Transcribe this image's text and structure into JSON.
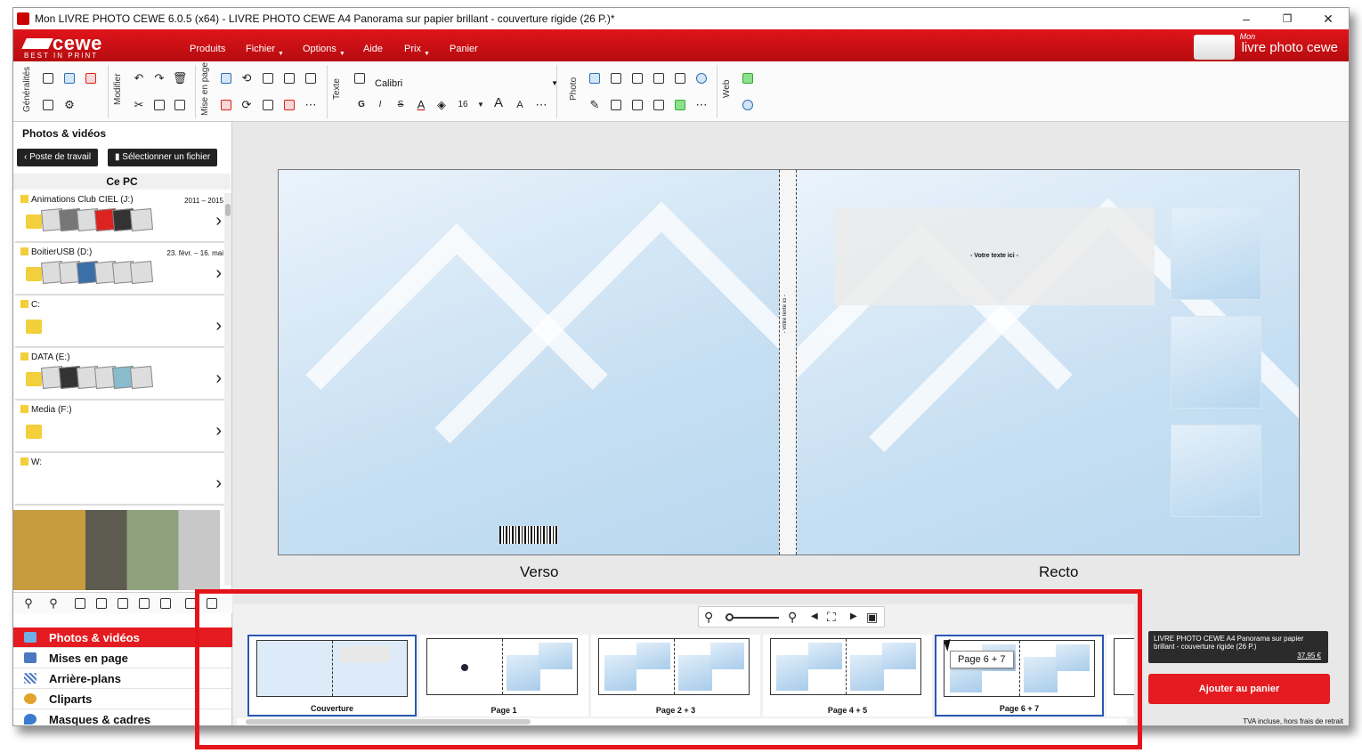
{
  "window": {
    "title": "Mon LIVRE PHOTO CEWE 6.0.5 (x64) - LIVRE PHOTO CEWE A4 Panorama sur papier brillant - couverture rigide  (26 P.)*",
    "minimize": "–",
    "maximize": "❐",
    "close": "✕"
  },
  "brand": {
    "logo_text": "cewe",
    "tagline": "BEST IN PRINT",
    "product_prefix": "Mon",
    "product_name": "livre photo cewe"
  },
  "menu": [
    "Produits",
    "Fichier",
    "Options",
    "Aide",
    "Prix",
    "Panier"
  ],
  "toolbar": {
    "groups": [
      "Généralités",
      "Modifier",
      "Mise en page",
      "Texte",
      "Photo",
      "Web"
    ],
    "font_name": "Calibri",
    "font_size": "16",
    "bold": "G",
    "italic": "I",
    "strike": "S",
    "grow": "A",
    "shrink": "A"
  },
  "left_panel": {
    "title": "Photos & vidéos",
    "back_button": "Poste de travail",
    "select_button": "Sélectionner un fichier",
    "location": "Ce PC",
    "drives": [
      {
        "name": "Animations Club CIEL (J:)",
        "date": "2011 – 2015"
      },
      {
        "name": "BoitierUSB (D:)",
        "date": "23. févr. – 16. mai"
      },
      {
        "name": "C:",
        "date": ""
      },
      {
        "name": "DATA (E:)",
        "date": ""
      },
      {
        "name": "Media (F:)",
        "date": ""
      },
      {
        "name": "W:",
        "date": ""
      }
    ]
  },
  "nav": [
    {
      "label": "Photos & vidéos",
      "icon": "photos-icon"
    },
    {
      "label": "Mises en page",
      "icon": "layouts-icon"
    },
    {
      "label": "Arrière-plans",
      "icon": "backgrounds-icon"
    },
    {
      "label": "Cliparts",
      "icon": "cliparts-icon"
    },
    {
      "label": "Masques & cadres",
      "icon": "masks-icon"
    }
  ],
  "canvas": {
    "placeholder_text": "- Votre texte ici -",
    "spine_text": "- Votre texte ici -",
    "left_label": "Verso",
    "right_label": "Recto"
  },
  "thumbnails": [
    {
      "label": "Couverture",
      "selected": true
    },
    {
      "label": "Page 1",
      "selected": false
    },
    {
      "label": "Page 2 + 3",
      "selected": false
    },
    {
      "label": "Page 4 + 5",
      "selected": false
    },
    {
      "label": "Page 6 + 7",
      "selected": true
    }
  ],
  "tooltip": "Page 6 + 7",
  "cart": {
    "product": "LIVRE PHOTO CEWE A4 Panorama sur papier brillant - couverture rigide  (26 P.)",
    "price": "37,95 €",
    "add_button": "Ajouter au panier",
    "tax_note": "TVA incluse, hors frais de retrait"
  },
  "colors": {
    "brand_red": "#e41b20",
    "selection_blue": "#2b57b4",
    "highlight_box": "#e4141b"
  }
}
